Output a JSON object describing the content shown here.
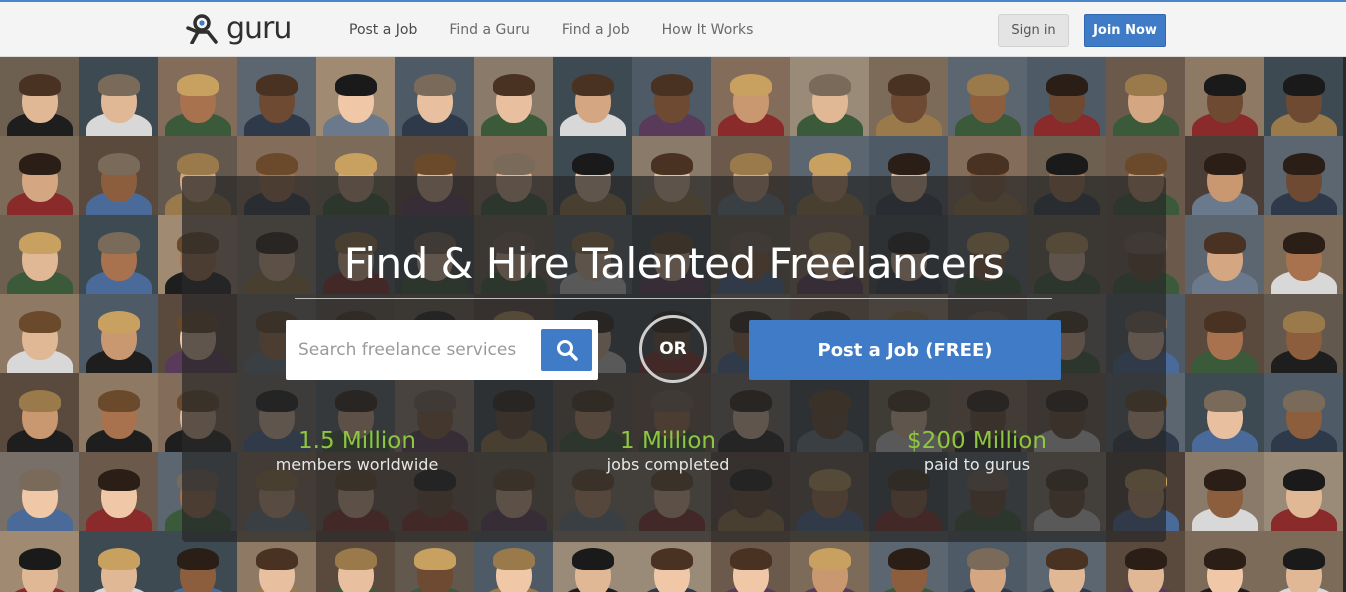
{
  "header": {
    "logo_text": "guru",
    "nav": [
      {
        "label": "Post a Job"
      },
      {
        "label": "Find a Guru"
      },
      {
        "label": "Find a Job"
      },
      {
        "label": "How It Works"
      }
    ],
    "signin_label": "Sign in",
    "join_label": "Join Now"
  },
  "hero": {
    "headline": "Find & Hire Talented Freelancers",
    "search_placeholder": "Search freelance services",
    "search_icon": "search-icon",
    "or_label": "OR",
    "post_job_label": "Post a Job (FREE)"
  },
  "stats": [
    {
      "value": "1.5 Million",
      "label": "members worldwide"
    },
    {
      "value": "1 Million",
      "label": "jobs completed"
    },
    {
      "value": "$200 Million",
      "label": "paid to gurus"
    }
  ],
  "colors": {
    "accent_blue": "#3f7bc6",
    "stat_green": "#8dc63f",
    "header_bg": "#f4f4f4"
  }
}
